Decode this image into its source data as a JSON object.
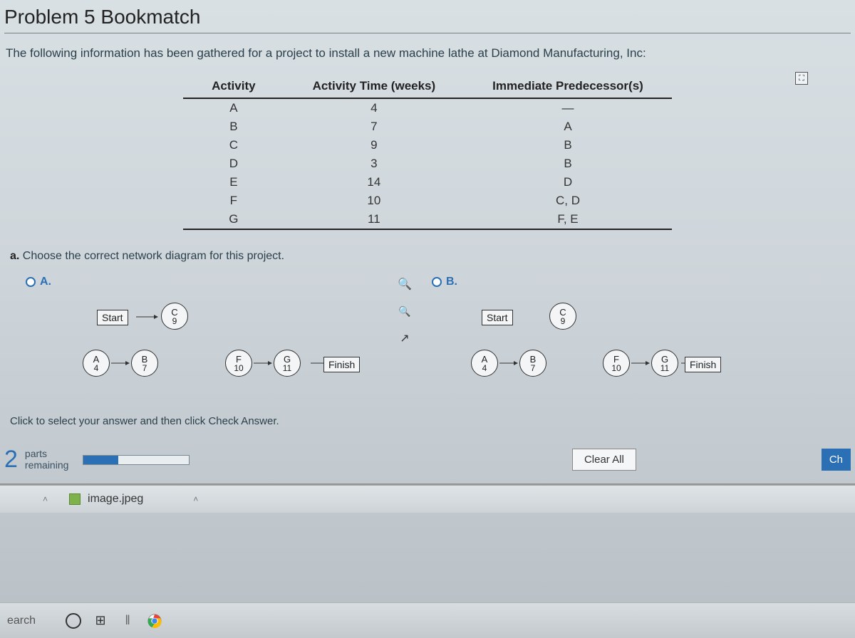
{
  "title": "Problem 5 Bookmatch",
  "intro": "The following information has been gathered for a project to install a new machine lathe at Diamond Manufacturing, Inc:",
  "table": {
    "headers": [
      "Activity",
      "Activity Time (weeks)",
      "Immediate Predecessor(s)"
    ],
    "rows": [
      {
        "activity": "A",
        "time": "4",
        "pred": "—"
      },
      {
        "activity": "B",
        "time": "7",
        "pred": "A"
      },
      {
        "activity": "C",
        "time": "9",
        "pred": "B"
      },
      {
        "activity": "D",
        "time": "3",
        "pred": "B"
      },
      {
        "activity": "E",
        "time": "14",
        "pred": "D"
      },
      {
        "activity": "F",
        "time": "10",
        "pred": "C, D"
      },
      {
        "activity": "G",
        "time": "11",
        "pred": "F, E"
      }
    ]
  },
  "question_a_prefix": "a.",
  "question_a": "Choose the correct network diagram for this project.",
  "options": {
    "a_label": "A.",
    "b_label": "B."
  },
  "nodes": {
    "start": "Start",
    "finish": "Finish",
    "A": {
      "t": "A",
      "b": "4"
    },
    "B": {
      "t": "B",
      "b": "7"
    },
    "C": {
      "t": "C",
      "b": "9"
    },
    "F": {
      "t": "F",
      "b": "10"
    },
    "G": {
      "t": "G",
      "b": "11"
    }
  },
  "instruction": "Click to select your answer and then click Check Answer.",
  "parts": {
    "count": "2",
    "line1": "parts",
    "line2": "remaining"
  },
  "buttons": {
    "clear": "Clear All",
    "check": "Ch"
  },
  "file": {
    "name": "image.jpeg"
  },
  "taskbar": {
    "search": "earch"
  }
}
